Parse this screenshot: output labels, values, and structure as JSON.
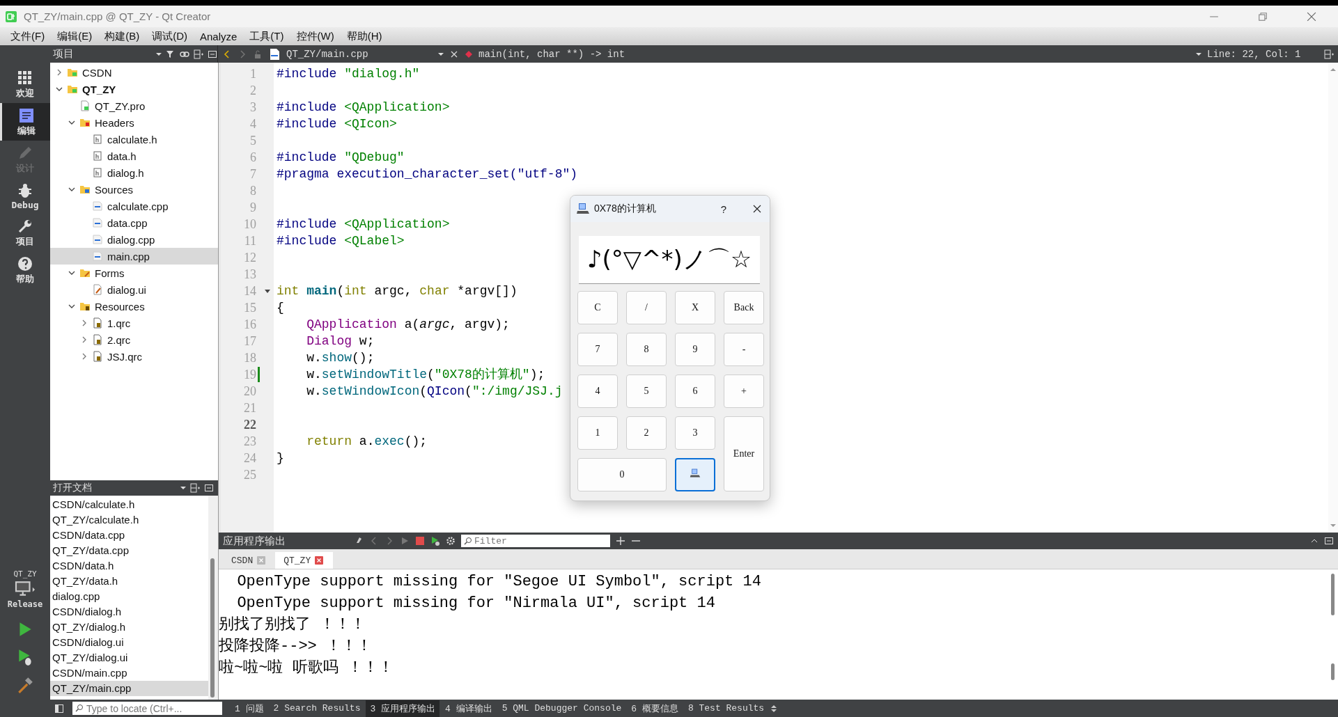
{
  "window": {
    "title": "QT_ZY/main.cpp @ QT_ZY - Qt Creator"
  },
  "menu": [
    "文件(F)",
    "编辑(E)",
    "构建(B)",
    "调试(D)",
    "Analyze",
    "工具(T)",
    "控件(W)",
    "帮助(H)"
  ],
  "mode_bar": {
    "items": [
      {
        "kind": "grid",
        "label": "欢迎",
        "selected": false,
        "disabled": false
      },
      {
        "kind": "document",
        "label": "编辑",
        "selected": true,
        "disabled": false
      },
      {
        "kind": "pencil",
        "label": "设计",
        "selected": false,
        "disabled": true
      },
      {
        "kind": "bug",
        "label": "Debug",
        "selected": false,
        "disabled": false
      },
      {
        "kind": "wrench",
        "label": "项目",
        "selected": false,
        "disabled": false
      },
      {
        "kind": "help",
        "label": "帮助",
        "selected": false,
        "disabled": false
      }
    ],
    "kit": {
      "project": "QT_ZY",
      "config": "Release"
    }
  },
  "project_panel": {
    "title": "项目",
    "items": [
      {
        "label": "CSDN",
        "kind": "project",
        "active": false,
        "expanded": false,
        "selected": false
      },
      {
        "label": "QT_ZY",
        "kind": "project",
        "active": true,
        "expanded": true,
        "selected": false,
        "children": [
          {
            "label": "QT_ZY.pro",
            "kind": "pro",
            "selected": false
          },
          {
            "label": "Headers",
            "kind": "folder-headers",
            "expanded": true,
            "selected": false,
            "children": [
              {
                "label": "calculate.h",
                "kind": "header",
                "selected": false
              },
              {
                "label": "data.h",
                "kind": "header",
                "selected": false
              },
              {
                "label": "dialog.h",
                "kind": "header",
                "selected": false
              }
            ]
          },
          {
            "label": "Sources",
            "kind": "folder-sources",
            "expanded": true,
            "selected": false,
            "children": [
              {
                "label": "calculate.cpp",
                "kind": "source",
                "selected": false
              },
              {
                "label": "data.cpp",
                "kind": "source",
                "selected": false
              },
              {
                "label": "dialog.cpp",
                "kind": "source",
                "selected": false
              },
              {
                "label": "main.cpp",
                "kind": "source",
                "selected": true
              }
            ]
          },
          {
            "label": "Forms",
            "kind": "folder-forms",
            "expanded": true,
            "selected": false,
            "children": [
              {
                "label": "dialog.ui",
                "kind": "form",
                "selected": false
              }
            ]
          },
          {
            "label": "Resources",
            "kind": "folder-resources",
            "expanded": true,
            "selected": false,
            "children": [
              {
                "label": "1.qrc",
                "kind": "resource",
                "expanded": false,
                "selected": false
              },
              {
                "label": "2.qrc",
                "kind": "resource",
                "expanded": false,
                "selected": false
              },
              {
                "label": "JSJ.qrc",
                "kind": "resource",
                "expanded": false,
                "selected": false
              }
            ]
          }
        ]
      }
    ]
  },
  "open_documents": {
    "title": "打开文档",
    "items": [
      {
        "label": "CSDN/calculate.h",
        "selected": false
      },
      {
        "label": "QT_ZY/calculate.h",
        "selected": false
      },
      {
        "label": "CSDN/data.cpp",
        "selected": false
      },
      {
        "label": "QT_ZY/data.cpp",
        "selected": false
      },
      {
        "label": "CSDN/data.h",
        "selected": false
      },
      {
        "label": "QT_ZY/data.h",
        "selected": false
      },
      {
        "label": "dialog.cpp",
        "selected": false
      },
      {
        "label": "CSDN/dialog.h",
        "selected": false
      },
      {
        "label": "QT_ZY/dialog.h",
        "selected": false
      },
      {
        "label": "CSDN/dialog.ui",
        "selected": false
      },
      {
        "label": "QT_ZY/dialog.ui",
        "selected": false
      },
      {
        "label": "CSDN/main.cpp",
        "selected": false
      },
      {
        "label": "QT_ZY/main.cpp",
        "selected": true
      }
    ]
  },
  "editor": {
    "file": "QT_ZY/main.cpp",
    "symbol": "main(int, char **) -> int",
    "position": "Line: 22, Col: 1",
    "lines": [
      {
        "number": "1",
        "current": false,
        "tokens": [
          {
            "kind": "preproc",
            "text": "#include "
          },
          {
            "kind": "string",
            "text": "\"dialog.h\""
          }
        ]
      },
      {
        "number": "2",
        "current": false
      },
      {
        "number": "3",
        "current": false,
        "tokens": [
          {
            "kind": "preproc",
            "text": "#include "
          },
          {
            "kind": "string",
            "text": "<QApplication>"
          }
        ]
      },
      {
        "number": "4",
        "current": false,
        "tokens": [
          {
            "kind": "preproc",
            "text": "#include "
          },
          {
            "kind": "string",
            "text": "<QIcon>"
          }
        ]
      },
      {
        "number": "5",
        "current": false
      },
      {
        "number": "6",
        "current": false,
        "tokens": [
          {
            "kind": "preproc",
            "text": "#include "
          },
          {
            "kind": "string",
            "text": "\"QDebug\""
          }
        ]
      },
      {
        "number": "7",
        "current": false,
        "tokens": [
          {
            "kind": "preproc",
            "text": "#pragma execution_character_set(\"utf-8\")"
          }
        ]
      },
      {
        "number": "8",
        "current": false
      },
      {
        "number": "9",
        "current": false
      },
      {
        "number": "10",
        "current": false,
        "tokens": [
          {
            "kind": "preproc",
            "text": "#include "
          },
          {
            "kind": "string",
            "text": "<QApplication>"
          }
        ]
      },
      {
        "number": "11",
        "current": false,
        "tokens": [
          {
            "kind": "preproc",
            "text": "#include "
          },
          {
            "kind": "string",
            "text": "<QLabel>"
          }
        ]
      },
      {
        "number": "12",
        "current": false
      },
      {
        "number": "13",
        "current": false
      },
      {
        "number": "14",
        "current": false,
        "foldable": true,
        "tokens": [
          {
            "kind": "keyword",
            "text": "int "
          },
          {
            "kind": "function",
            "text": "main"
          },
          {
            "kind": "plain",
            "text": "("
          },
          {
            "kind": "keyword",
            "text": "int"
          },
          {
            "kind": "plain",
            "text": " argc, "
          },
          {
            "kind": "keyword",
            "text": "char"
          },
          {
            "kind": "plain",
            "text": " *argv[])"
          }
        ]
      },
      {
        "number": "15",
        "current": false,
        "tokens": [
          {
            "kind": "plain",
            "text": "{"
          }
        ]
      },
      {
        "number": "16",
        "current": false,
        "tokens": [
          {
            "kind": "class",
            "text": "    QApplication"
          },
          {
            "kind": "plain",
            "text": " a("
          },
          {
            "kind": "param",
            "text": "argc"
          },
          {
            "kind": "plain",
            "text": ", argv);"
          }
        ]
      },
      {
        "number": "17",
        "current": false,
        "tokens": [
          {
            "kind": "class",
            "text": "    Dialog"
          },
          {
            "kind": "plain",
            "text": " w;"
          }
        ]
      },
      {
        "number": "18",
        "current": false,
        "tokens": [
          {
            "kind": "plain",
            "text": "    w."
          },
          {
            "kind": "method",
            "text": "show"
          },
          {
            "kind": "plain",
            "text": "();"
          }
        ]
      },
      {
        "number": "19",
        "current": false,
        "modified": true,
        "tokens": [
          {
            "kind": "plain",
            "text": "    w."
          },
          {
            "kind": "method",
            "text": "setWindowTitle"
          },
          {
            "kind": "plain",
            "text": "("
          },
          {
            "kind": "string",
            "text": "\"0X78的计算机\""
          },
          {
            "kind": "plain",
            "text": ");"
          }
        ]
      },
      {
        "number": "20",
        "current": false,
        "tokens": [
          {
            "kind": "plain",
            "text": "    w."
          },
          {
            "kind": "method",
            "text": "setWindowIcon"
          },
          {
            "kind": "plain",
            "text": "("
          },
          {
            "kind": "preproc",
            "text": "QIcon"
          },
          {
            "kind": "plain",
            "text": "("
          },
          {
            "kind": "string",
            "text": "\":/img/JSJ.j"
          }
        ]
      },
      {
        "number": "21",
        "current": false
      },
      {
        "number": "22",
        "current": true
      },
      {
        "number": "23",
        "current": false,
        "tokens": [
          {
            "kind": "keyword",
            "text": "    return"
          },
          {
            "kind": "plain",
            "text": " a."
          },
          {
            "kind": "method",
            "text": "exec"
          },
          {
            "kind": "plain",
            "text": "();"
          }
        ]
      },
      {
        "number": "24",
        "current": false,
        "tokens": [
          {
            "kind": "plain",
            "text": "}"
          }
        ]
      },
      {
        "number": "25",
        "current": false
      }
    ]
  },
  "dialog": {
    "title": "0X78的计算机",
    "help": "?",
    "display": "♪(°▽^*)ノ⌒☆",
    "buttons": [
      {
        "kind": "text",
        "label": "C",
        "focused": false
      },
      {
        "kind": "text",
        "label": "/",
        "focused": false
      },
      {
        "kind": "text",
        "label": "X",
        "focused": false
      },
      {
        "kind": "text",
        "label": "Back",
        "focused": false
      },
      {
        "kind": "text",
        "label": "7",
        "focused": false
      },
      {
        "kind": "text",
        "label": "8",
        "focused": false
      },
      {
        "kind": "text",
        "label": "9",
        "focused": false
      },
      {
        "kind": "text",
        "label": "-",
        "focused": false
      },
      {
        "kind": "text",
        "label": "4",
        "focused": false
      },
      {
        "kind": "text",
        "label": "5",
        "focused": false
      },
      {
        "kind": "text",
        "label": "6",
        "focused": false
      },
      {
        "kind": "text",
        "label": "+",
        "focused": false
      },
      {
        "kind": "text",
        "label": "1",
        "focused": false
      },
      {
        "kind": "text",
        "label": "2",
        "focused": false
      },
      {
        "kind": "text",
        "label": "3",
        "focused": false
      },
      {
        "kind": "text",
        "label": "Enter",
        "tall": true,
        "focused": false
      },
      {
        "kind": "text",
        "label": "0",
        "wide": true,
        "focused": false
      },
      {
        "kind": "icon",
        "focused": true
      }
    ]
  },
  "output_pane": {
    "title": "应用程序输出",
    "filter": {
      "placeholder": "Filter"
    },
    "tabs": [
      {
        "label": "CSDN",
        "selected": false
      },
      {
        "label": "QT_ZY",
        "selected": true
      }
    ],
    "lines": [
      "  OpenType support missing for \"Segoe UI Symbol\", script 14",
      "  OpenType support missing for \"Nirmala UI\", script 14",
      "别找了别找了 ！！！",
      "投降投降-->> ！！！",
      "啦~啦~啦 听歌吗 ！！！"
    ]
  },
  "status_bar": {
    "locate": {
      "placeholder": "Type to locate (Ctrl+..."
    },
    "items": [
      {
        "label": "1 问题",
        "selected": false
      },
      {
        "label": "2 Search Results",
        "selected": false
      },
      {
        "label": "3 应用程序输出",
        "selected": true
      },
      {
        "label": "4 编译输出",
        "selected": false
      },
      {
        "label": "5 QML Debugger Console",
        "selected": false
      },
      {
        "label": "6 概要信息",
        "selected": false
      },
      {
        "label": "8 Test Results",
        "selected": false
      }
    ]
  }
}
